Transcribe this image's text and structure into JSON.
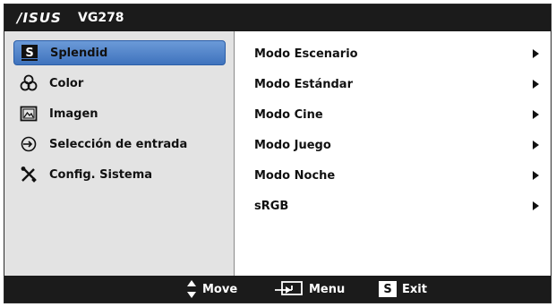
{
  "header": {
    "logo": "/ISUS",
    "model": "VG278"
  },
  "left_menu": {
    "items": [
      {
        "label": "Splendid",
        "icon": "splendid-s-icon",
        "selected": true
      },
      {
        "label": "Color",
        "icon": "color-circles-icon",
        "selected": false
      },
      {
        "label": "Imagen",
        "icon": "image-icon",
        "selected": false
      },
      {
        "label": "Selección de entrada",
        "icon": "input-source-icon",
        "selected": false
      },
      {
        "label": "Config. Sistema",
        "icon": "tools-icon",
        "selected": false
      }
    ]
  },
  "right_menu": {
    "items": [
      {
        "label": "Modo Escenario"
      },
      {
        "label": "Modo Estándar"
      },
      {
        "label": "Modo Cine"
      },
      {
        "label": "Modo Juego"
      },
      {
        "label": "Modo Noche"
      },
      {
        "label": "sRGB"
      }
    ]
  },
  "footer": {
    "move_label": "Move",
    "menu_label": "Menu",
    "exit_label": "Exit",
    "exit_icon_letter": "S"
  },
  "colors": {
    "bar": "#1b1b1b",
    "left_panel": "#e3e3e3",
    "selected": "#4f82c9"
  }
}
